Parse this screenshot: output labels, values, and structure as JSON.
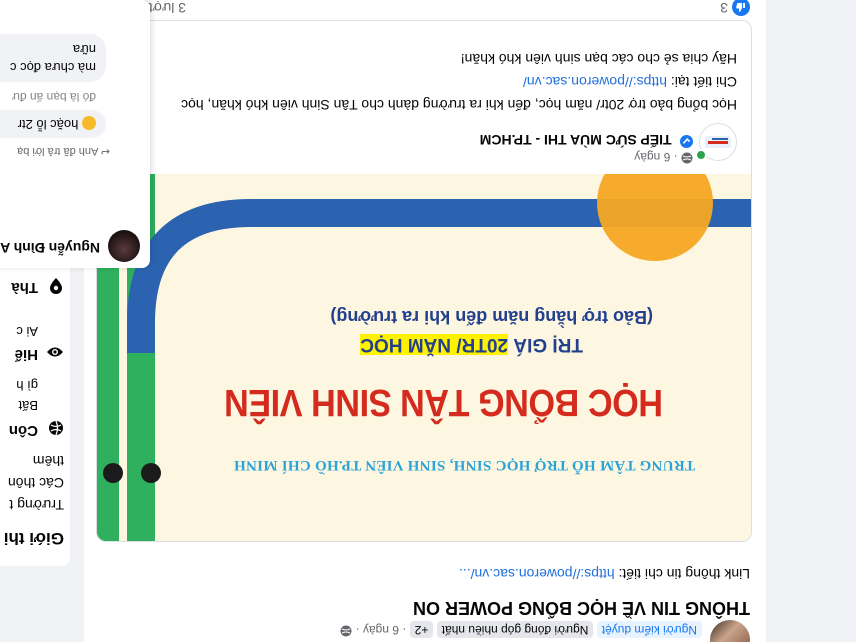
{
  "group_post": {
    "author_badges": [
      "Người kiểm duyệt",
      "Người đóng góp nhiều nhất",
      "+2"
    ],
    "time": "6 ngày",
    "title": "THÔNG TIN VỀ HỌC BỔNG POWER ON",
    "body_prefix": "Link thông tin chi tiết: ",
    "body_link": "https://poweron.sac.vn/..."
  },
  "shared_post": {
    "author": "TIẾP SỨC MÙA THI - TP.HCM",
    "time": "6 ngày",
    "line1": "Học bổng bảo trợ 20tr/ năm học, đến khi ra trường dành cho Tân Sinh viên khó khăn, học",
    "line2_prefix": "Chi tiết tại: ",
    "line2_link": "https://poweron.sac.vn/",
    "line3": "Hãy chia sẻ cho các bạn sinh viên khó khăn!"
  },
  "banner": {
    "org": "TRUNG TÂM HỖ TRỢ HỌC SINH, SINH VIÊN TP.HỒ CHÍ MINH",
    "title": "HỌC BỔNG TÂN SINH VIÊN",
    "value_prefix": "TRỊ GIÁ ",
    "value_highlight": "20TR/ NĂM HỌC",
    "note": "(Bảo trợ hằng năm đến khi ra trường)"
  },
  "footer": {
    "likes": "3",
    "shares": "3 lượt"
  },
  "sidebar": {
    "heading": "Giới thi",
    "lines": [
      "Trường t",
      "Các thôn",
      "thêm"
    ],
    "items": [
      {
        "title": "Côn",
        "desc": [
          "Bất",
          "gì h"
        ]
      },
      {
        "title": "Hiể",
        "desc": [
          "Ai c"
        ]
      },
      {
        "title": "Thà",
        "desc": []
      }
    ]
  },
  "comments": {
    "name": "Nguyễn Đình A",
    "reply_hint": "Anh đã trả lời bạ",
    "lines_top": [
      "nữa",
      "mà chưa đọc c"
    ],
    "faded": "đó là bạn ấn đư",
    "reply": "hoặc lỗ 2tr"
  },
  "colors": {
    "accent": "#1877f2",
    "banner_bg": "#fdf7e1",
    "banner_red": "#d52b1e",
    "banner_blue": "#2b63b0",
    "banner_green": "#2eb05e",
    "banner_orange": "#f5a623"
  }
}
